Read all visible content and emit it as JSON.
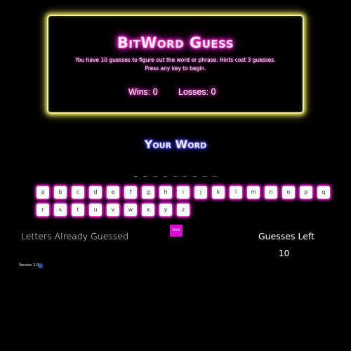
{
  "header": {
    "title": "BitWord Guess",
    "instructions_line1": "You have 10 guesses to figure out the word or phrase. Hints cost 3 guesses.",
    "instructions_line2": "Press any key to begin.",
    "wins_text": "Wins: 0",
    "losses_text": "Losses: 0"
  },
  "word": {
    "heading": "Your Word",
    "display": "_ _ _ _ _ _ _ _ _"
  },
  "keyboard": {
    "row1": [
      "a",
      "b",
      "c",
      "d",
      "e",
      "f",
      "g",
      "h",
      "i",
      "j",
      "k",
      "l",
      "m",
      "n",
      "o",
      "p",
      "q"
    ],
    "row2": [
      "r",
      "s",
      "t",
      "u",
      "v",
      "w",
      "x",
      "y",
      "z"
    ]
  },
  "hint": {
    "label": "hint"
  },
  "letters_guessed": {
    "label": "Letters Already Guessed"
  },
  "guesses_left": {
    "label": "Guesses Left",
    "value": "10"
  },
  "footer": {
    "version": "Version 1.0",
    "icon": "github-icon"
  },
  "colors": {
    "background": "#000000",
    "panel_glow": "#e6e25a",
    "pink_glow": "#ff2fd0",
    "blue_glow": "#4a4aff",
    "hint_button": "#d60fd0"
  }
}
